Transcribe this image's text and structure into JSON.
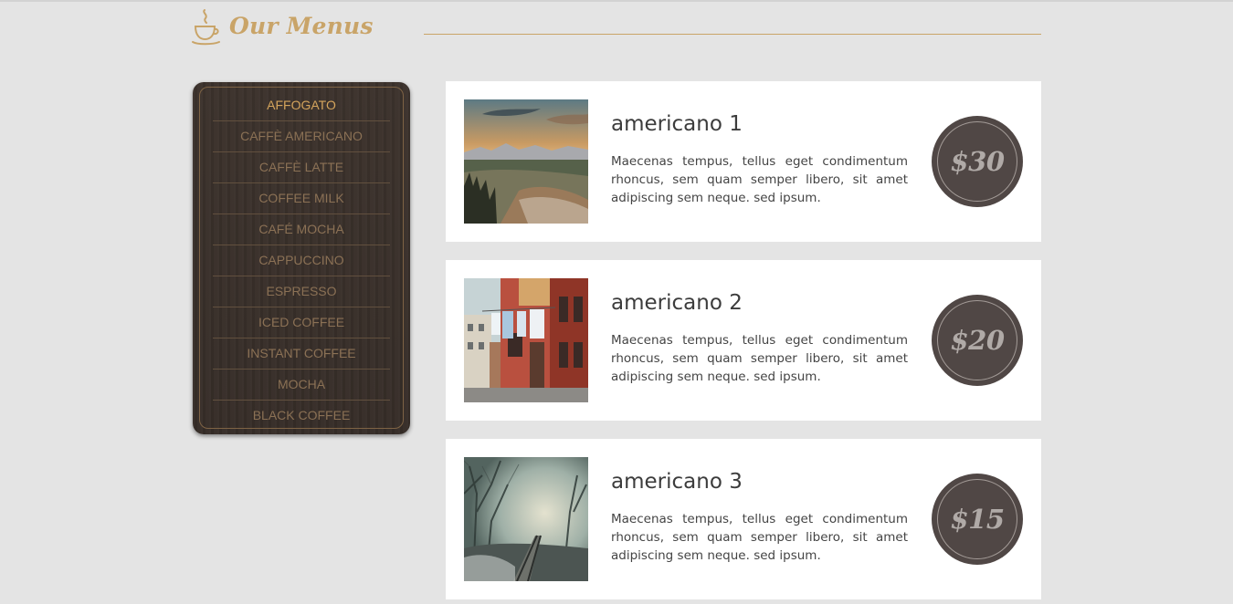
{
  "header": {
    "title": "Our Menus",
    "icon": "coffee-cup-icon",
    "accent_color": "#c9a468"
  },
  "sidebar": {
    "items": [
      {
        "label": "AFFOGATO",
        "active": true
      },
      {
        "label": "CAFFÈ AMERICANO"
      },
      {
        "label": "CAFFÈ LATTE"
      },
      {
        "label": "COFFEE MILK"
      },
      {
        "label": "CAFÉ MOCHA"
      },
      {
        "label": "CAPPUCCINO"
      },
      {
        "label": "ESPRESSO"
      },
      {
        "label": "ICED COFFEE"
      },
      {
        "label": "INSTANT COFFEE"
      },
      {
        "label": "MOCHA"
      },
      {
        "label": "BLACK COFFEE"
      }
    ]
  },
  "menu_items": [
    {
      "title": "americano 1",
      "description": "Maecenas tempus, tellus eget condimentum rhoncus, sem quam semper libero, sit amet adipiscing sem neque. sed ipsum.",
      "price": "$30",
      "image": "mountain-sunset-photo"
    },
    {
      "title": "americano 2",
      "description": "Maecenas tempus, tellus eget condimentum rhoncus, sem quam semper libero, sit amet adipiscing sem neque. sed ipsum.",
      "price": "$20",
      "image": "street-buildings-photo"
    },
    {
      "title": "americano 3",
      "description": "Maecenas tempus, tellus eget condimentum rhoncus, sem quam semper libero, sit amet adipiscing sem neque. sed ipsum.",
      "price": "$15",
      "image": "foggy-railway-photo"
    }
  ]
}
